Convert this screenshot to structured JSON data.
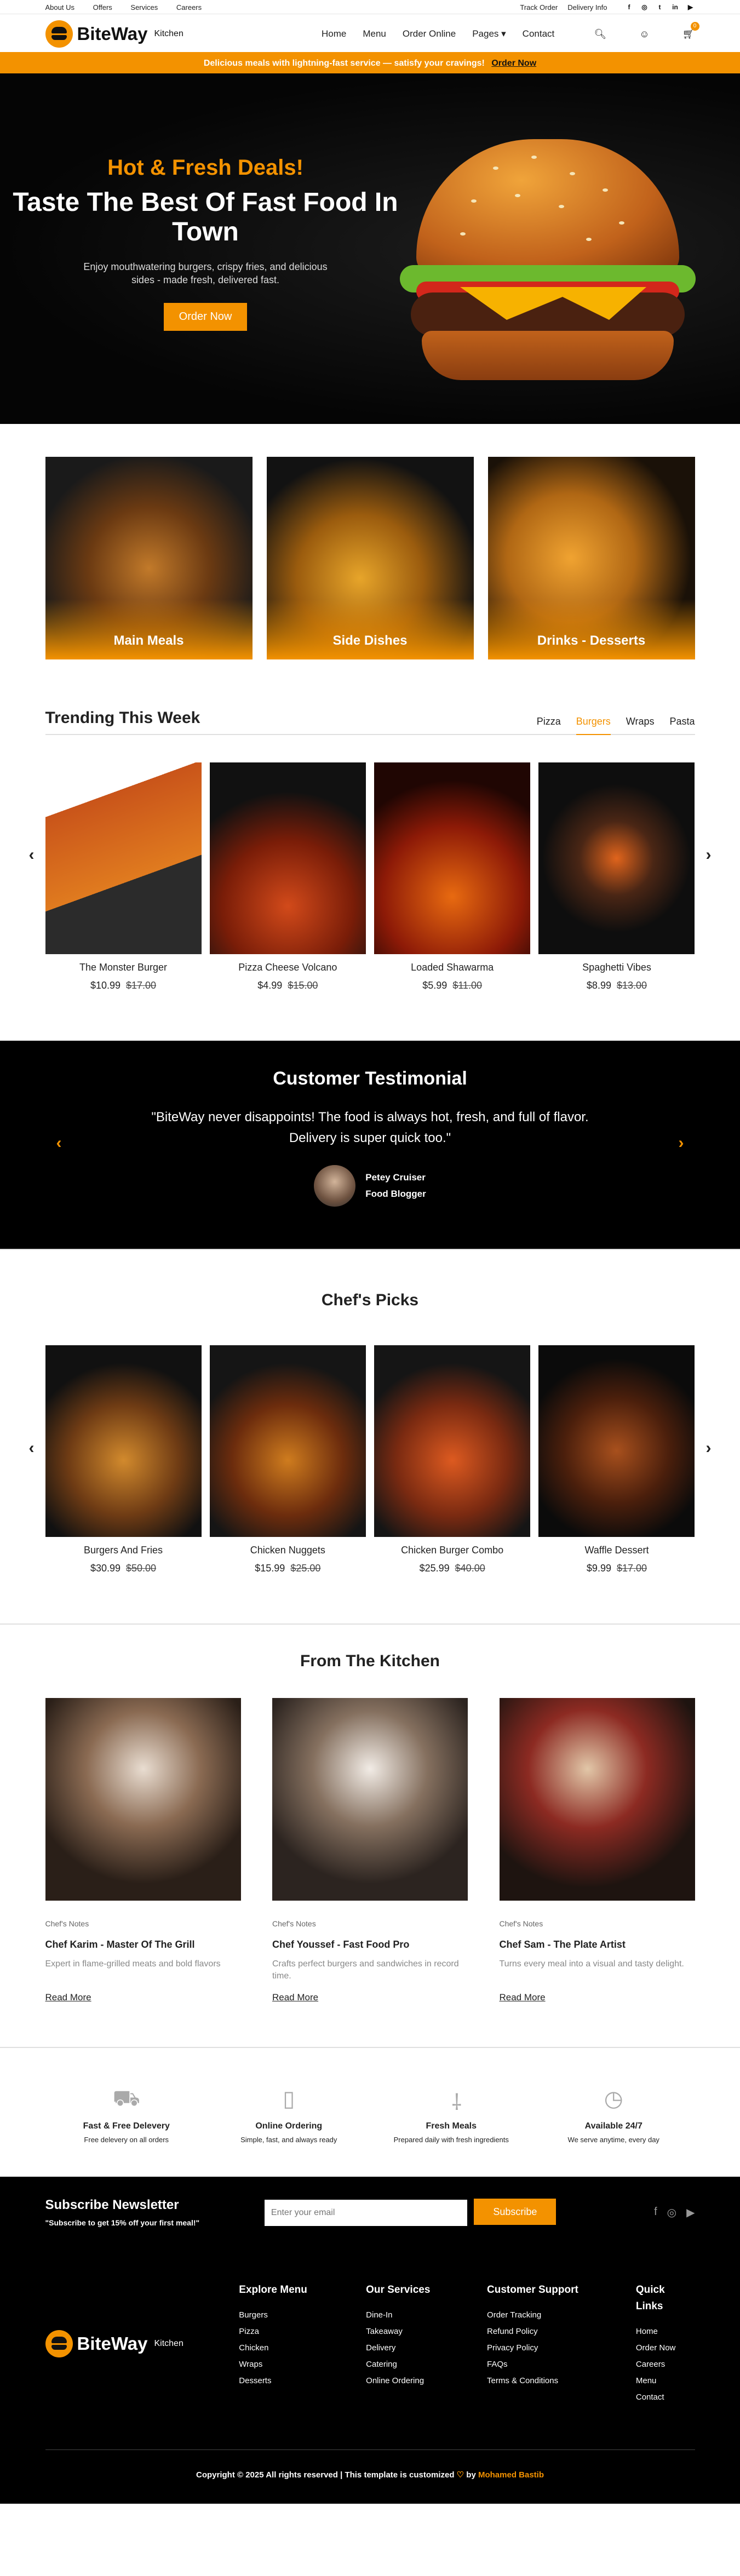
{
  "topbar": {
    "links": [
      "About Us",
      "Offers",
      "Services",
      "Careers"
    ],
    "right_links": [
      "Track Order",
      "Delivery Info"
    ],
    "social_icons": [
      "facebook-icon",
      "instagram-icon",
      "twitter-icon",
      "linkedin-icon",
      "youtube-icon"
    ]
  },
  "header": {
    "brand": "BiteWay",
    "brand_sub": "Kitchen",
    "nav": [
      "Home",
      "Menu",
      "Order Online",
      "Pages",
      "Contact"
    ],
    "cart_count": "0"
  },
  "promo": {
    "text": "Delicious meals with lightning-fast service — satisfy your cravings!",
    "cta": "Order Now"
  },
  "hero": {
    "kicker": "Hot & Fresh Deals!",
    "title": "Taste The Best Of Fast Food In Town",
    "desc": "Enjoy mouthwatering burgers, crispy fries, and delicious sides - made fresh, delivered fast.",
    "cta": "Order Now"
  },
  "categories": [
    "Main Meals",
    "Side Dishes",
    "Drinks - Desserts"
  ],
  "trending": {
    "title": "Trending This Week",
    "tabs": [
      "Pizza",
      "Burgers",
      "Wraps",
      "Pasta"
    ],
    "active_tab": "Burgers",
    "items": [
      {
        "name": "The Monster Burger",
        "price": "$10.99",
        "old": "$17.00"
      },
      {
        "name": "Pizza Cheese Volcano",
        "price": "$4.99",
        "old": "$15.00"
      },
      {
        "name": "Loaded Shawarma",
        "price": "$5.99",
        "old": "$11.00"
      },
      {
        "name": "Spaghetti Vibes",
        "price": "$8.99",
        "old": "$13.00"
      }
    ]
  },
  "testimonial": {
    "title": "Customer Testimonial",
    "quote": "\"BiteWay never disappoints! The food is always hot, fresh, and full of flavor. Delivery is super quick too.\"",
    "name": "Petey Cruiser",
    "role": "Food Blogger"
  },
  "picks": {
    "title": "Chef's Picks",
    "items": [
      {
        "name": "Burgers And Fries",
        "price": "$30.99",
        "old": "$50.00"
      },
      {
        "name": "Chicken Nuggets",
        "price": "$15.99",
        "old": "$25.00"
      },
      {
        "name": "Chicken Burger Combo",
        "price": "$25.99",
        "old": "$40.00"
      },
      {
        "name": "Waffle Dessert",
        "price": "$9.99",
        "old": "$17.00"
      }
    ]
  },
  "kitchen": {
    "title": "From The Kitchen",
    "posts": [
      {
        "tag": "Chef's Notes",
        "title": "Chef Karim - Master Of The Grill",
        "desc": "Expert in flame-grilled meats and bold flavors",
        "cta": "Read More"
      },
      {
        "tag": "Chef's Notes",
        "title": "Chef Youssef - Fast Food Pro",
        "desc": "Crafts perfect burgers and sandwiches in record time.",
        "cta": "Read More"
      },
      {
        "tag": "Chef's Notes",
        "title": "Chef Sam - The Plate Artist",
        "desc": "Turns every meal into a visual and tasty delight.",
        "cta": "Read More"
      }
    ]
  },
  "features": [
    {
      "icon": "truck-icon",
      "title": "Fast & Free Delevery",
      "desc": "Free delevery on all orders"
    },
    {
      "icon": "phone-icon",
      "title": "Online Ordering",
      "desc": "Simple, fast, and always ready"
    },
    {
      "icon": "utensils-icon",
      "title": "Fresh Meals",
      "desc": "Prepared daily with fresh ingredients"
    },
    {
      "icon": "clock-icon",
      "title": "Available 24/7",
      "desc": "We serve anytime, every day"
    }
  ],
  "footer": {
    "newsletter_title": "Subscribe Newsletter",
    "newsletter_sub": "\"Subscribe to get 15% off your first meal!\"",
    "email_placeholder": "Enter your email",
    "subscribe": "Subscribe",
    "columns": [
      {
        "title": "Explore Menu",
        "items": [
          "Burgers",
          "Pizza",
          "Chicken",
          "Wraps",
          "Desserts"
        ]
      },
      {
        "title": "Our Services",
        "items": [
          "Dine-In",
          "Takeaway",
          "Delivery",
          "Catering",
          "Online Ordering"
        ]
      },
      {
        "title": "Customer Support",
        "items": [
          "Order Tracking",
          "Refund Policy",
          "Privacy Policy",
          "FAQs",
          "Terms & Conditions"
        ]
      },
      {
        "title": "Quick Links",
        "items": [
          "Home",
          "Order Now",
          "Careers",
          "Menu",
          "Contact"
        ]
      }
    ],
    "copyright": "Copyright © 2025 All rights reserved | This template is customized",
    "by": "by",
    "author": "Mohamed Bastib"
  },
  "colors": {
    "accent": "#f39200",
    "dark": "#000000"
  }
}
